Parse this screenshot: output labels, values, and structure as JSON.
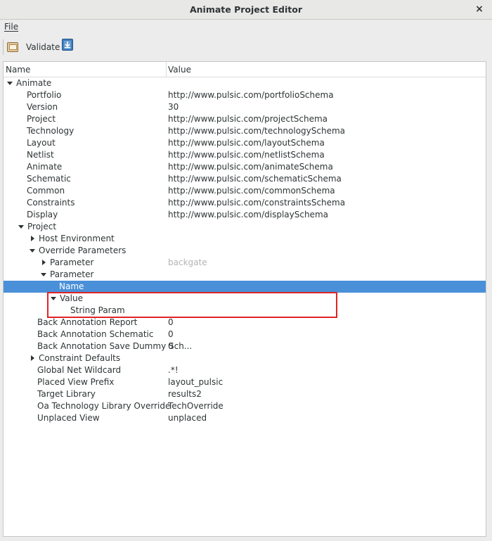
{
  "window": {
    "title": "Animate Project Editor",
    "close_glyph": "×"
  },
  "menu": {
    "file": "File"
  },
  "toolbar": {
    "validate_label": "Validate",
    "validate_icon": "validate-icon",
    "save_icon": "download-icon"
  },
  "tree": {
    "columns": {
      "name": "Name",
      "value": "Value"
    },
    "rows": [
      {
        "name": "Animate",
        "value": "",
        "exp": "down"
      },
      {
        "name": "Portfolio",
        "value": "http://www.pulsic.com/portfolioSchema"
      },
      {
        "name": "Version",
        "value": "30"
      },
      {
        "name": "Project",
        "value": "http://www.pulsic.com/projectSchema"
      },
      {
        "name": "Technology",
        "value": "http://www.pulsic.com/technologySchema"
      },
      {
        "name": "Layout",
        "value": "http://www.pulsic.com/layoutSchema"
      },
      {
        "name": "Netlist",
        "value": "http://www.pulsic.com/netlistSchema"
      },
      {
        "name": "Animate",
        "value": "http://www.pulsic.com/animateSchema"
      },
      {
        "name": "Schematic",
        "value": "http://www.pulsic.com/schematicSchema"
      },
      {
        "name": "Common",
        "value": "http://www.pulsic.com/commonSchema"
      },
      {
        "name": "Constraints",
        "value": "http://www.pulsic.com/constraintsSchema"
      },
      {
        "name": "Display",
        "value": "http://www.pulsic.com/displaySchema"
      },
      {
        "name": "Project",
        "value": "",
        "exp": "down"
      },
      {
        "name": "Host Environment",
        "value": "",
        "exp": "right"
      },
      {
        "name": "Override Parameters",
        "value": "",
        "exp": "down"
      },
      {
        "name": "Parameter",
        "value": "backgate",
        "exp": "right",
        "dim": true
      },
      {
        "name": "Parameter",
        "value": "",
        "exp": "down"
      },
      {
        "name": "Name",
        "value": "",
        "selected": true
      },
      {
        "name": "Value",
        "value": "",
        "exp": "down"
      },
      {
        "name": "String Param",
        "value": ""
      },
      {
        "name": "Back Annotation Report",
        "value": "0"
      },
      {
        "name": "Back Annotation Schematic",
        "value": "0"
      },
      {
        "name": "Back Annotation Save Dummy Sch...",
        "value": "0"
      },
      {
        "name": "Constraint Defaults",
        "value": "",
        "exp": "right"
      },
      {
        "name": "Global Net Wildcard",
        "value": ".*!"
      },
      {
        "name": "Placed View Prefix",
        "value": "layout_pulsic"
      },
      {
        "name": "Target Library",
        "value": "results2"
      },
      {
        "name": "Oa Technology Library Override",
        "value": "TechOverride"
      },
      {
        "name": "Unplaced View",
        "value": "unplaced"
      }
    ]
  },
  "colors": {
    "selection": "#4a90d9",
    "highlight_box": "#e02424"
  }
}
